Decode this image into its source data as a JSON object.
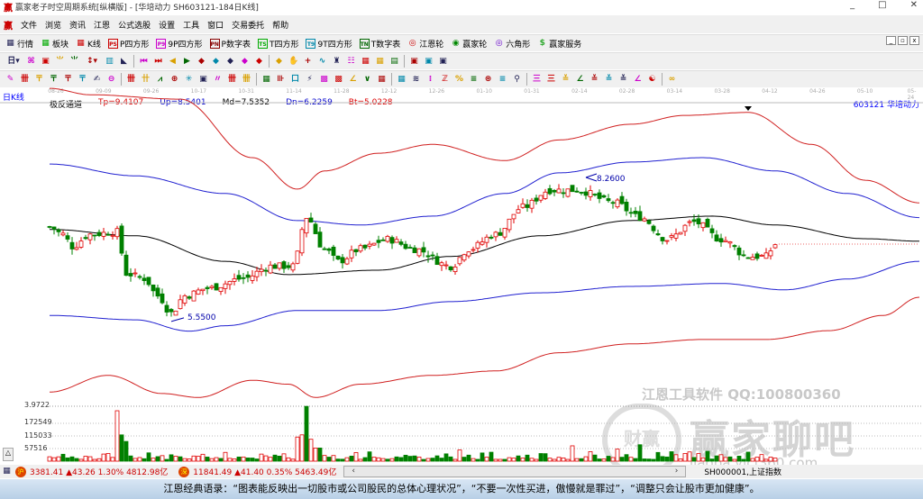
{
  "window": {
    "title": "赢家老子时空周期系统[纵横版] - [华培动力 SH603121-184日K线]",
    "min": "_",
    "max": "□",
    "close": "✕"
  },
  "menu": [
    "文件",
    "浏览",
    "资讯",
    "江恩",
    "公式选股",
    "设置",
    "工具",
    "窗口",
    "交易委托",
    "帮助"
  ],
  "toolbar1": [
    {
      "icon": "grid-icon",
      "label": "行情",
      "color": "#225"
    },
    {
      "icon": "blocks-icon",
      "label": "板块",
      "color": "#0a0"
    },
    {
      "icon": "kline-icon",
      "label": "K线",
      "color": "#c00"
    },
    {
      "icon": "p-square-icon",
      "glyph": "PS",
      "label": "P四方形",
      "color": "#c00"
    },
    {
      "icon": "9p-square-icon",
      "glyph": "P9",
      "label": "9P四方形",
      "color": "#c0c"
    },
    {
      "icon": "p-table-icon",
      "glyph": "PN",
      "label": "P数字表",
      "color": "#800"
    },
    {
      "icon": "t-square-icon",
      "glyph": "TS",
      "label": "T四方形",
      "color": "#0a0"
    },
    {
      "icon": "9t-square-icon",
      "glyph": "T9",
      "label": "9T四方形",
      "color": "#08a"
    },
    {
      "icon": "t-table-icon",
      "glyph": "TN",
      "label": "T数字表",
      "color": "#060"
    },
    {
      "icon": "gann-wheel-icon",
      "glyph": "◎",
      "label": "江恩轮",
      "color": "#c00"
    },
    {
      "icon": "winner-wheel-icon",
      "glyph": "◉",
      "label": "赢家轮",
      "color": "#080"
    },
    {
      "icon": "hexagon-icon",
      "glyph": "◎",
      "label": "六角形",
      "color": "#60c"
    },
    {
      "icon": "dollar-icon",
      "glyph": "$",
      "label": "赢家服务",
      "color": "#3a3"
    }
  ],
  "toolbar2_glyphs": [
    "日▾",
    "⌘",
    "▣",
    "⺌",
    "⺌",
    "↕▾",
    "▥",
    "◣",
    "⏮",
    "⏭",
    "◀",
    "▶",
    "◆",
    "◆",
    "◆",
    "◆",
    "◆",
    "◆",
    "✋",
    "+",
    "∿",
    "♜",
    "☷",
    "▦",
    "▦",
    "▤",
    "▣",
    "▣",
    "▣"
  ],
  "toolbar3_glyphs": [
    "✎",
    "卌",
    "〒",
    "〒",
    "〒",
    "〒",
    "✍",
    "⊖",
    "卌",
    "卄",
    "⩘",
    "⊕",
    "✳",
    "▣",
    "〃",
    "卌",
    "卌",
    "▦",
    "⊪",
    "口",
    "⚡",
    "▩",
    "▩",
    "∠",
    "∨",
    "▦",
    "▦",
    "≋",
    "⁞",
    "ℤ",
    "%",
    "≡",
    "⊛",
    "≡",
    "⚲",
    "三",
    "三",
    "≚",
    "∠",
    "≚",
    "≚",
    "≚",
    "∠",
    "☯",
    "∞"
  ],
  "chart": {
    "period_label": "日K线",
    "indicator": {
      "name": "极反通道",
      "tp": "Tp=9.4107",
      "up": "Up=8.5401",
      "md": "Md=7.5352",
      "dn": "Dn=6.2259",
      "bt": "Bt=5.0228"
    },
    "stock": "603121 华培动力",
    "dates": [
      "08-26",
      "09-09",
      "09-26",
      "10-17",
      "10-31",
      "11-14",
      "11-28",
      "12-12",
      "12-26",
      "01-10",
      "01-31",
      "02-14",
      "02-28",
      "03-14",
      "03-28",
      "04-12",
      "04-26",
      "05-10",
      "05-24"
    ],
    "high_label": "8.2600",
    "low_label": "5.5500",
    "high_index": 119,
    "low_index": 27,
    "price_range": [
      3.77,
      9.91
    ],
    "close_keypoints": [
      [
        0,
        7.4
      ],
      [
        3,
        7.25
      ],
      [
        5,
        7.0
      ],
      [
        9,
        7.25
      ],
      [
        15,
        7.3
      ],
      [
        17,
        6.45
      ],
      [
        21,
        6.35
      ],
      [
        24,
        6.0
      ],
      [
        27,
        5.65
      ],
      [
        30,
        6.0
      ],
      [
        35,
        6.15
      ],
      [
        43,
        6.35
      ],
      [
        49,
        6.6
      ],
      [
        54,
        6.6
      ],
      [
        57,
        7.6
      ],
      [
        61,
        6.95
      ],
      [
        64,
        6.7
      ],
      [
        69,
        6.95
      ],
      [
        75,
        7.15
      ],
      [
        81,
        6.95
      ],
      [
        89,
        6.6
      ],
      [
        93,
        6.95
      ],
      [
        99,
        7.25
      ],
      [
        105,
        7.8
      ],
      [
        111,
        8.15
      ],
      [
        117,
        8.15
      ],
      [
        125,
        7.9
      ],
      [
        131,
        7.6
      ],
      [
        137,
        7.15
      ],
      [
        143,
        7.5
      ],
      [
        149,
        7.15
      ],
      [
        155,
        6.8
      ],
      [
        159,
        6.8
      ],
      [
        161,
        7.05
      ]
    ],
    "lines": [
      {
        "name": "tp-line",
        "color": "#d02020",
        "points": [
          [
            0,
            10.22
          ],
          [
            9,
            10.09
          ],
          [
            29,
            10.0
          ],
          [
            45,
            8.81
          ],
          [
            55,
            8.17
          ],
          [
            61,
            8.54
          ],
          [
            73,
            8.9
          ],
          [
            85,
            9.08
          ],
          [
            101,
            8.75
          ],
          [
            113,
            9.17
          ],
          [
            129,
            9.49
          ],
          [
            141,
            9.67
          ],
          [
            155,
            9.73
          ],
          [
            169,
            9.08
          ],
          [
            181,
            8.35
          ],
          [
            193,
            7.89
          ]
        ]
      },
      {
        "name": "up-line",
        "color": "#2020d0",
        "points": [
          [
            0,
            8.68
          ],
          [
            19,
            8.44
          ],
          [
            39,
            8.08
          ],
          [
            55,
            7.53
          ],
          [
            69,
            7.44
          ],
          [
            85,
            7.62
          ],
          [
            101,
            8.08
          ],
          [
            113,
            8.5
          ],
          [
            129,
            8.72
          ],
          [
            145,
            8.81
          ],
          [
            161,
            8.54
          ],
          [
            177,
            8.08
          ],
          [
            193,
            7.59
          ]
        ]
      },
      {
        "name": "md-line",
        "color": "#000000",
        "points": [
          [
            0,
            7.35
          ],
          [
            19,
            7.22
          ],
          [
            39,
            6.7
          ],
          [
            53,
            6.43
          ],
          [
            73,
            6.52
          ],
          [
            89,
            6.8
          ],
          [
            109,
            7.22
          ],
          [
            129,
            7.53
          ],
          [
            147,
            7.62
          ],
          [
            161,
            7.44
          ],
          [
            181,
            7.16
          ],
          [
            193,
            7.11
          ]
        ]
      },
      {
        "name": "dn-line",
        "color": "#2020d0",
        "points": [
          [
            0,
            5.6
          ],
          [
            19,
            5.51
          ],
          [
            31,
            5.28
          ],
          [
            39,
            5.39
          ],
          [
            55,
            5.7
          ],
          [
            73,
            5.7
          ],
          [
            89,
            5.88
          ],
          [
            109,
            6.06
          ],
          [
            129,
            6.19
          ],
          [
            149,
            6.25
          ],
          [
            163,
            6.12
          ],
          [
            177,
            6.34
          ],
          [
            193,
            6.7
          ]
        ]
      },
      {
        "name": "bt-line",
        "color": "#d02020",
        "points": [
          [
            0,
            4.04
          ],
          [
            13,
            4.38
          ],
          [
            25,
            4.01
          ],
          [
            33,
            3.93
          ],
          [
            45,
            4.28
          ],
          [
            53,
            4.2
          ],
          [
            59,
            3.93
          ],
          [
            69,
            4.2
          ],
          [
            85,
            4.38
          ],
          [
            99,
            4.47
          ],
          [
            113,
            4.84
          ],
          [
            129,
            5.02
          ],
          [
            145,
            5.11
          ],
          [
            159,
            5.11
          ],
          [
            173,
            5.29
          ],
          [
            185,
            5.6
          ],
          [
            193,
            5.97
          ]
        ]
      }
    ],
    "last_close": 7.05
  },
  "volume": {
    "scale_top": "3.9722",
    "ticks": [
      "172549",
      "115033",
      "57516"
    ],
    "tick_values": [
      172549,
      115033,
      57516
    ],
    "max": 230000,
    "spikes": [
      [
        15,
        230000
      ],
      [
        16,
        120000
      ],
      [
        17,
        90000
      ],
      [
        55,
        110000
      ],
      [
        56,
        120000
      ],
      [
        57,
        250000
      ],
      [
        58,
        100000
      ],
      [
        59,
        60000
      ],
      [
        60,
        60000
      ],
      [
        116,
        70000
      ],
      [
        126,
        55000
      ],
      [
        131,
        75000
      ],
      [
        146,
        45000
      ]
    ]
  },
  "status": {
    "sh": "3381.41 ▲43.26 1.30% 4812.98亿",
    "sz": "11841.49 ▲41.40 0.35% 5463.49亿",
    "sh_icon": "沪",
    "sz_icon": "深",
    "index": "SH000001,上证指数",
    "scroll_left": "‹",
    "scroll_right": "›"
  },
  "watermark": {
    "line1": "江恩工具软件  QQ:100800360",
    "brand": "赢家聊吧",
    "url": "jiaoba.yjcf360.com",
    "seal": "财赢"
  },
  "footer": "江恩经典语录：“图表能反映出一切股市或公司股民的总体心理状况”，“不要一次性买进，傲慢就是罪过”，“调整只会让股市更加健康”。"
}
